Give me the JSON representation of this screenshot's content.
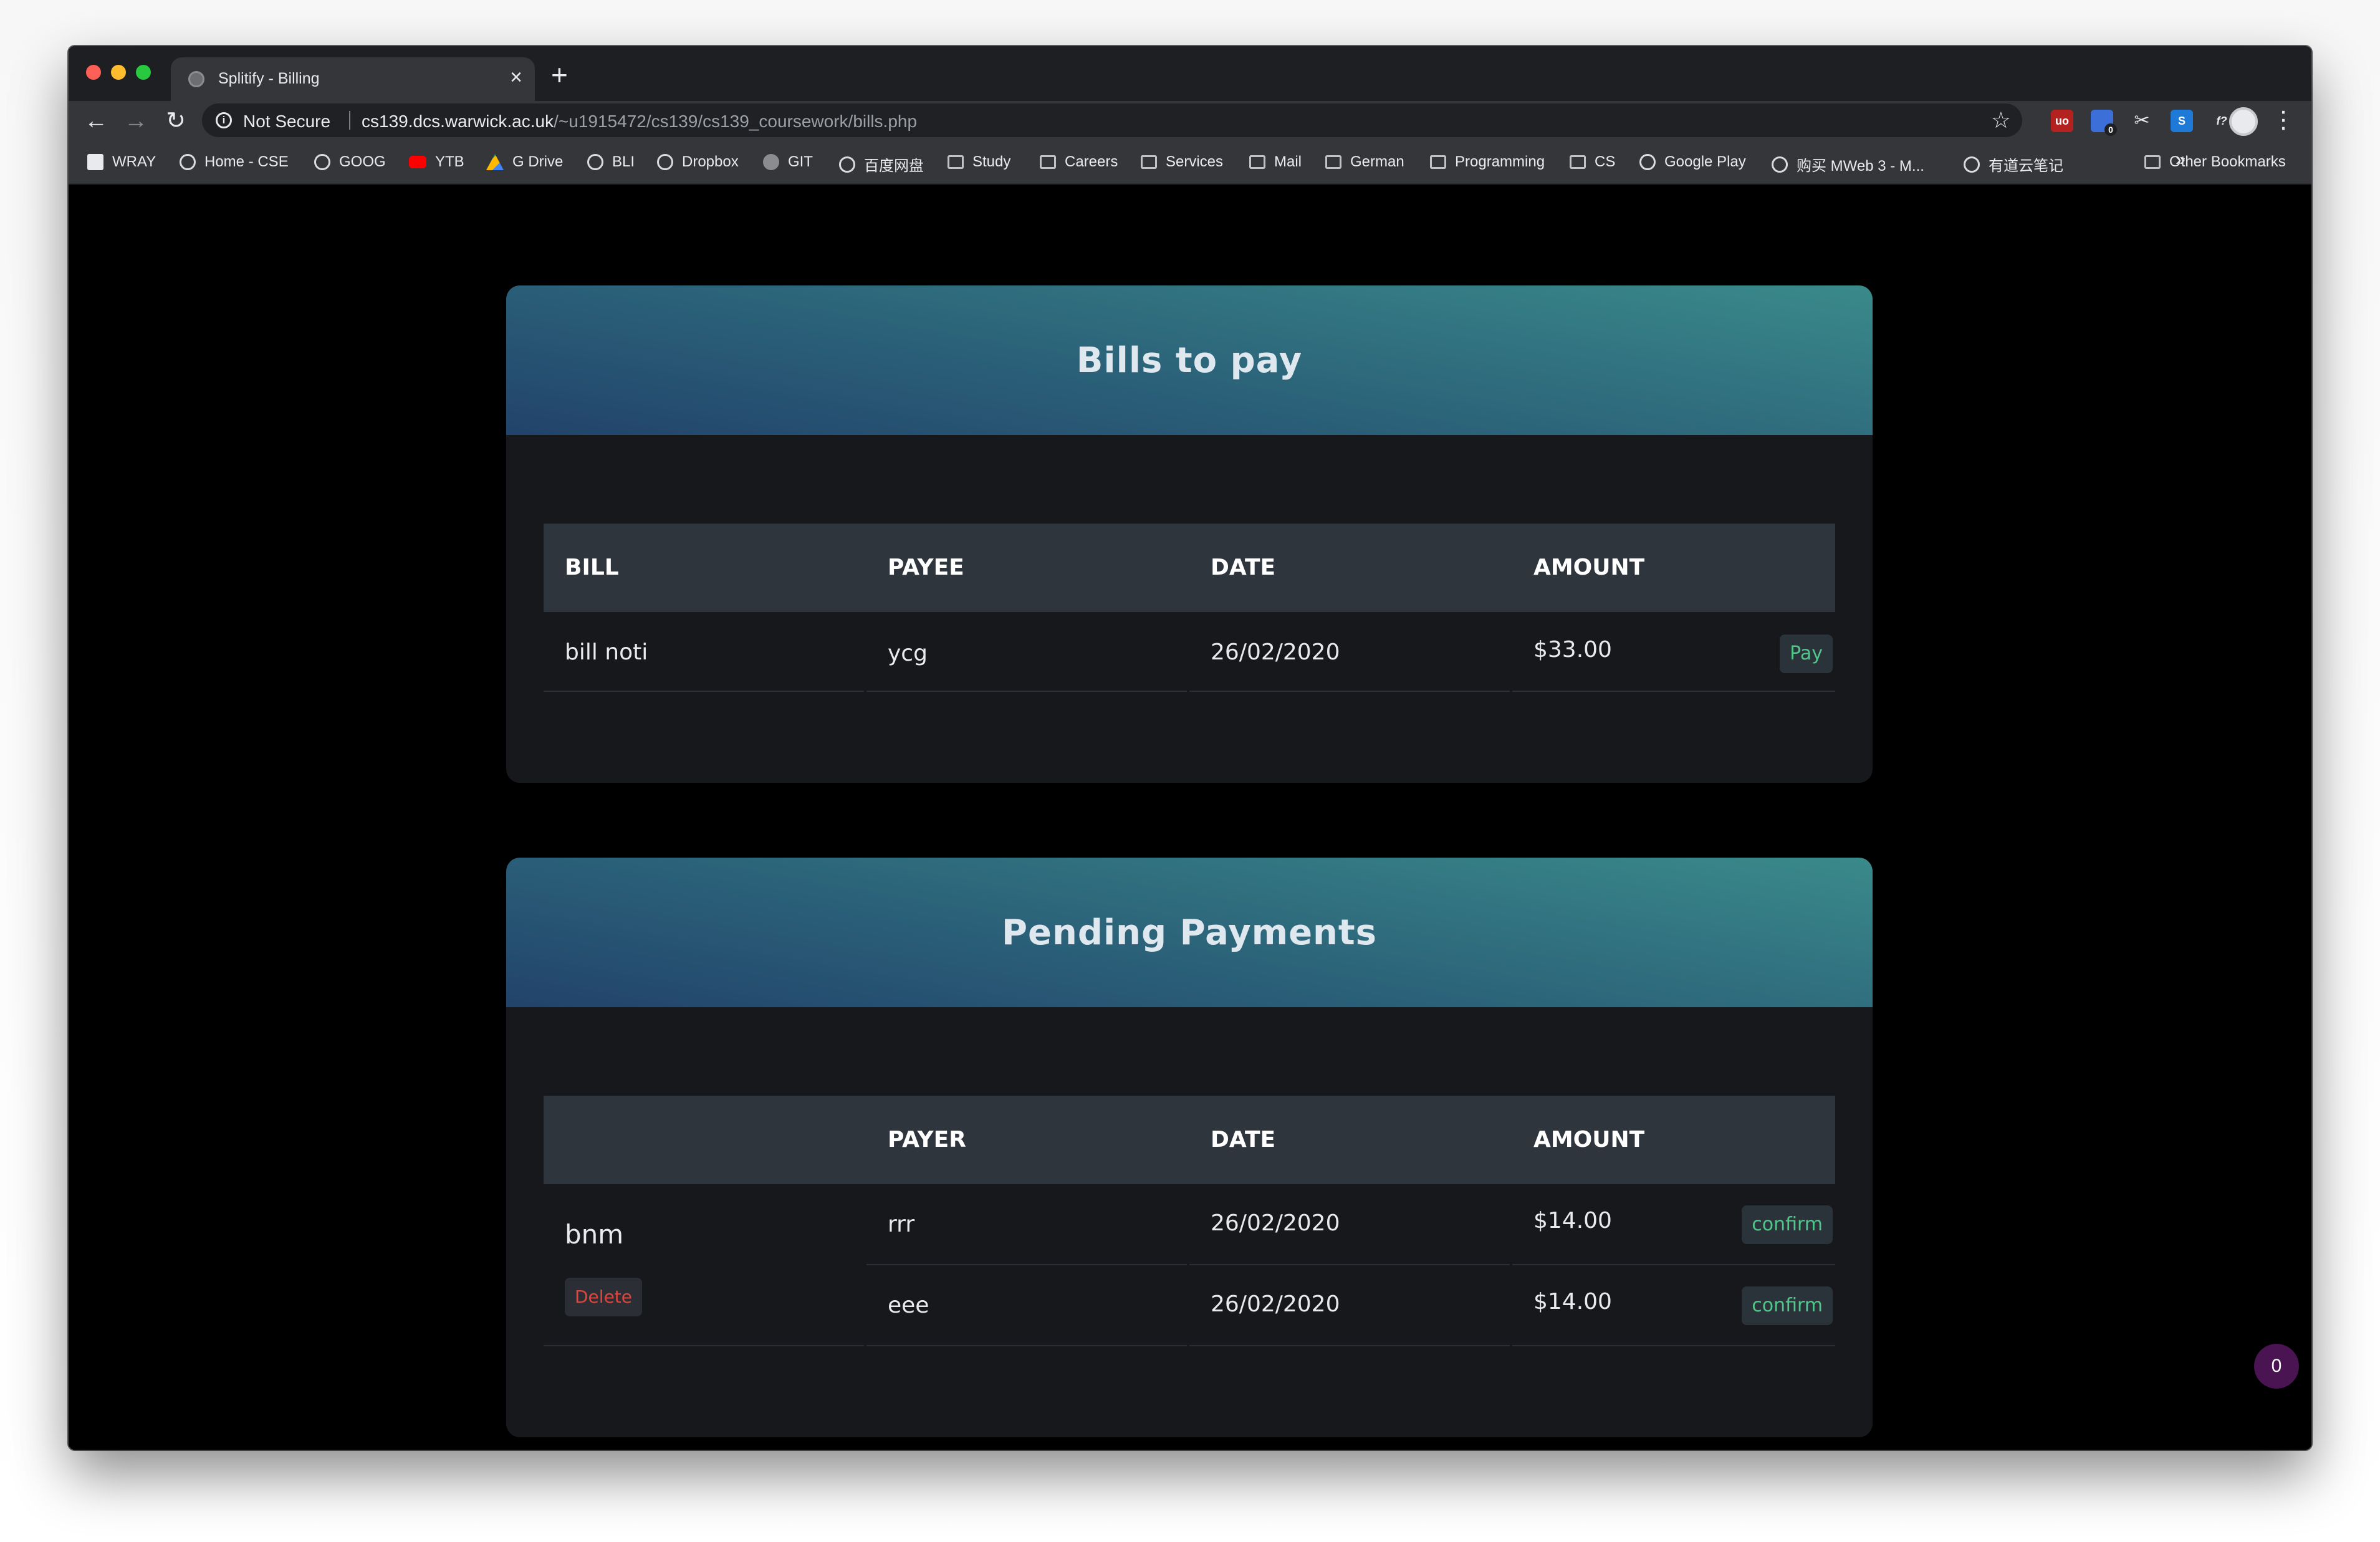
{
  "browser": {
    "tab_title": "Splitify - Billing",
    "tab_close": "×",
    "new_tab": "+",
    "back": "←",
    "forward": "→",
    "reload": "↻",
    "security_icon": "i",
    "security_label": "Not Secure",
    "url_host": "cs139.dcs.warwick.ac.uk",
    "url_path": "/~u1915472/cs139/cs139_coursework/bills.php",
    "star": "☆",
    "menu": "⋮",
    "extension_badge": "0"
  },
  "bookmarks": {
    "items": [
      {
        "label": "WRAY",
        "icon": "doc-icon"
      },
      {
        "label": "Home - CSE",
        "icon": "globe-icon"
      },
      {
        "label": "GOOG",
        "icon": "globe-icon"
      },
      {
        "label": "YTB",
        "icon": "youtube-icon"
      },
      {
        "label": "G Drive",
        "icon": "drive-icon"
      },
      {
        "label": "BLI",
        "icon": "globe-icon"
      },
      {
        "label": "Dropbox",
        "icon": "globe-icon"
      },
      {
        "label": "GIT",
        "icon": "github-icon"
      },
      {
        "label": "百度网盘",
        "icon": "globe-icon"
      },
      {
        "label": "Study",
        "icon": "folder-icon"
      },
      {
        "label": "Careers",
        "icon": "folder-icon"
      },
      {
        "label": "Services",
        "icon": "folder-icon"
      },
      {
        "label": "Mail",
        "icon": "folder-icon"
      },
      {
        "label": "German",
        "icon": "folder-icon"
      },
      {
        "label": "Programming",
        "icon": "folder-icon"
      },
      {
        "label": "CS",
        "icon": "folder-icon"
      },
      {
        "label": "Google Play",
        "icon": "globe-icon"
      },
      {
        "label": "购买 MWeb 3 - M...",
        "icon": "globe-icon"
      },
      {
        "label": "有道云笔记",
        "icon": "globe-icon"
      }
    ],
    "more": "»",
    "other": "Other Bookmarks"
  },
  "bills": {
    "title": "Bills to pay",
    "headers": [
      "BILL",
      "PAYEE",
      "DATE",
      "AMOUNT"
    ],
    "rows": [
      {
        "bill": "bill noti",
        "payee": "ycg",
        "date": "26/02/2020",
        "amount": "$33.00",
        "action": "Pay"
      }
    ]
  },
  "pending": {
    "title": "Pending Payments",
    "headers": [
      "",
      "PAYER",
      "DATE",
      "AMOUNT"
    ],
    "bill_name": "bnm",
    "delete_label": "Delete",
    "rows": [
      {
        "payer": "rrr",
        "date": "26/02/2020",
        "amount": "$14.00",
        "action": "confirm"
      },
      {
        "payer": "eee",
        "date": "26/02/2020",
        "amount": "$14.00",
        "action": "confirm"
      }
    ]
  },
  "notification_badge": "0",
  "colors": {
    "accent_green": "#52c58a",
    "danger_red": "#e0453d",
    "header_gradient_start": "#22436a",
    "header_gradient_end": "#3a8a8a"
  }
}
